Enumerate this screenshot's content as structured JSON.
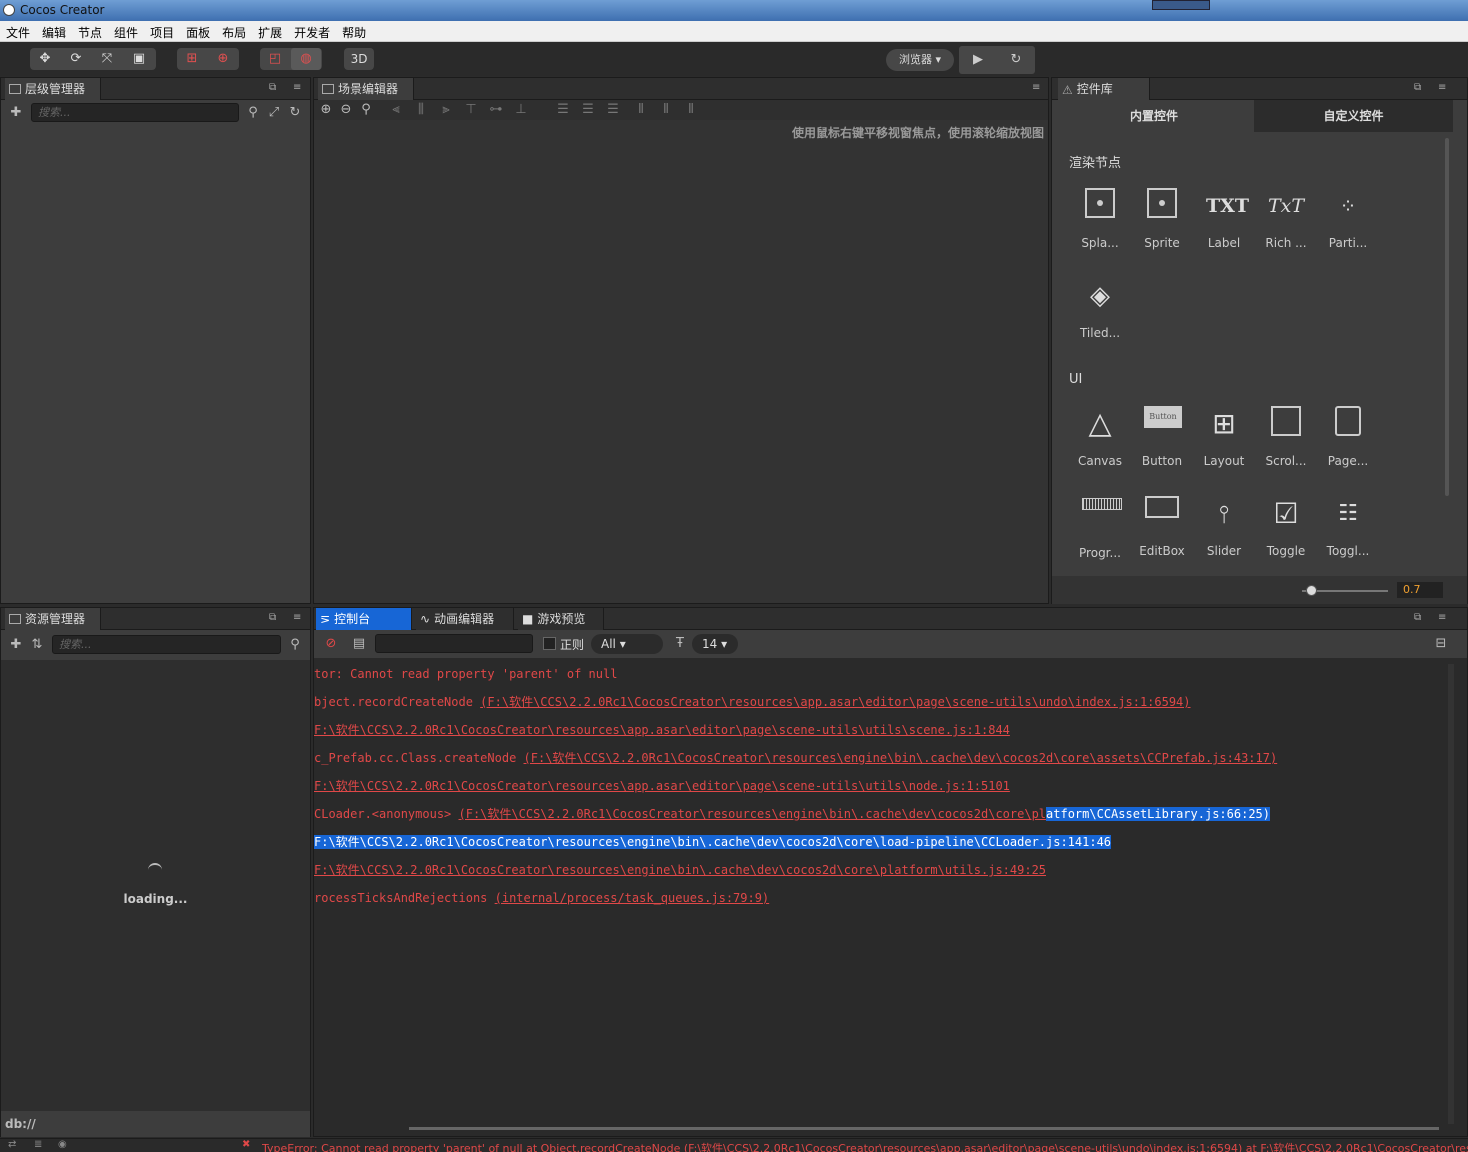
{
  "window": {
    "title": "Cocos Creator"
  },
  "menu": [
    "文件",
    "编辑",
    "节点",
    "组件",
    "项目",
    "面板",
    "布局",
    "扩展",
    "开发者",
    "帮助"
  ],
  "toolbar": {
    "btn3d": "3D",
    "browser": "浏览器 ▾",
    "play": "▶",
    "refresh": "↻"
  },
  "hierarchy": {
    "title": "层级管理器",
    "search_placeholder": "搜索..."
  },
  "scene": {
    "title": "场景编辑器",
    "hint": "使用鼠标右键平移视窗焦点，使用滚轮缩放视图"
  },
  "library": {
    "title": "控件库",
    "tabs": [
      "内置控件",
      "自定义控件"
    ],
    "render_section": "渲染节点",
    "render_items": [
      {
        "label": "Spla...",
        "icon": "splash-sprite-icon"
      },
      {
        "label": "Sprite",
        "icon": "sprite-icon"
      },
      {
        "label": "Label",
        "icon": "label-icon"
      },
      {
        "label": "Rich ...",
        "icon": "richtext-icon"
      },
      {
        "label": "Parti...",
        "icon": "particle-icon"
      },
      {
        "label": "Tiled...",
        "icon": "tiledmap-icon"
      }
    ],
    "ui_section": "UI",
    "ui_items": [
      {
        "label": "Canvas",
        "icon": "canvas-icon"
      },
      {
        "label": "Button",
        "icon": "button-icon"
      },
      {
        "label": "Layout",
        "icon": "layout-icon"
      },
      {
        "label": "Scrol...",
        "icon": "scrollview-icon"
      },
      {
        "label": "Page...",
        "icon": "pageview-icon"
      },
      {
        "label": "Progr...",
        "icon": "progressbar-icon"
      },
      {
        "label": "EditBox",
        "icon": "editbox-icon"
      },
      {
        "label": "Slider",
        "icon": "slider-icon"
      },
      {
        "label": "Toggle",
        "icon": "toggle-icon"
      },
      {
        "label": "Toggl...",
        "icon": "togglegroup-icon"
      }
    ],
    "zoom_value": "0.7",
    "zoom_fraction": 0.1,
    "button_text": "Button",
    "txt_glyph": "TXT",
    "rich_glyph": "TxT"
  },
  "assets": {
    "title": "资源管理器",
    "search_placeholder": "搜索...",
    "loading": "loading...",
    "path": "db://"
  },
  "console": {
    "tabs": [
      "控制台",
      "动画编辑器",
      "游戏预览"
    ],
    "regex_label": "正则",
    "level": "All ▾",
    "font_size": "14 ▾",
    "lines": [
      {
        "pre": "tor: Cannot read property 'parent' of null",
        "link": "",
        "hl": ""
      },
      {
        "pre": "bject.recordCreateNode  ",
        "link": "(F:\\软件\\CCS\\2.2.0Rc1\\CocosCreator\\resources\\app.asar\\editor\\page\\scene-utils\\undo\\index.js:1:6594)",
        "hl": ""
      },
      {
        "pre": "",
        "link": "F:\\软件\\CCS\\2.2.0Rc1\\CocosCreator\\resources\\app.asar\\editor\\page\\scene-utils\\utils\\scene.js:1:844",
        "hl": ""
      },
      {
        "pre": "c_Prefab.cc.Class.createNode  ",
        "link": "(F:\\软件\\CCS\\2.2.0Rc1\\CocosCreator\\resources\\engine\\bin\\.cache\\dev\\cocos2d\\core\\assets\\CCPrefab.js:43:17)",
        "hl": ""
      },
      {
        "pre": "",
        "link": "F:\\软件\\CCS\\2.2.0Rc1\\CocosCreator\\resources\\app.asar\\editor\\page\\scene-utils\\utils\\node.js:1:5101",
        "hl": ""
      },
      {
        "pre": "CLoader.<anonymous>  ",
        "link": "(F:\\软件\\CCS\\2.2.0Rc1\\CocosCreator\\resources\\engine\\bin\\.cache\\dev\\cocos2d\\core\\pl",
        "hl": "atform\\CCAssetLibrary.js:66:25)"
      },
      {
        "pre": "",
        "link": "",
        "hl": "F:\\软件\\CCS\\2.2.0Rc1\\CocosCreator\\resources\\engine\\bin\\.cache\\dev\\cocos2d\\core\\load-pipeline\\CCLoader.js:141:46"
      },
      {
        "pre": "",
        "link": "F:\\软件\\CCS\\2.2.0Rc1\\CocosCreator\\resources\\engine\\bin\\.cache\\dev\\cocos2d\\core\\platform\\utils.js:49:25",
        "hl": ""
      },
      {
        "pre": "rocessTicksAndRejections  ",
        "link": "(internal/process/task_queues.js:79:9)",
        "hl": ""
      }
    ]
  },
  "status": {
    "error": "TypeError: Cannot read property 'parent' of null at Object.recordCreateNode (F:\\软件\\CCS\\2.2.0Rc1\\CocosCreator\\resources\\app.asar\\editor\\page\\scene-utils\\undo\\index.js:1:6594) at F:\\软件\\CCS\\2.2.0Rc1\\CocosCreator\\resour"
  },
  "colors": {
    "error": "#e04848",
    "highlight": "#1766d6",
    "accent": "#f0a030"
  }
}
